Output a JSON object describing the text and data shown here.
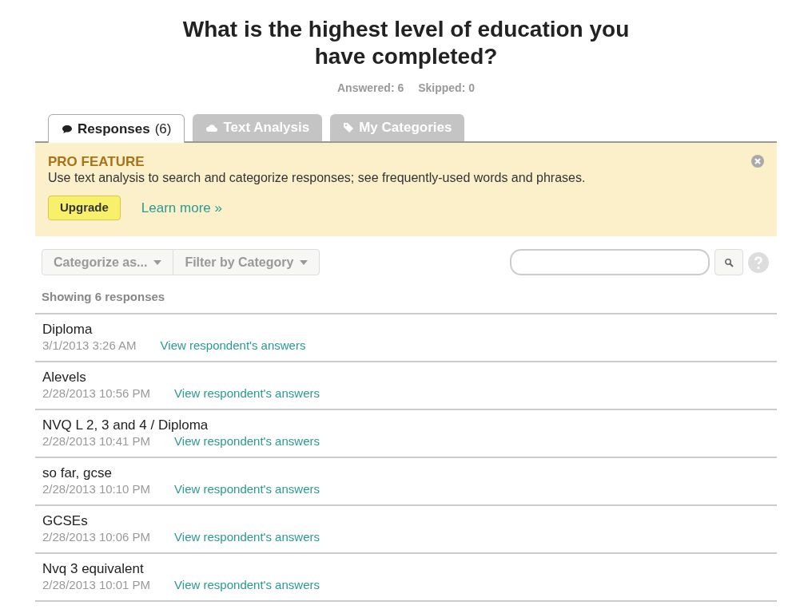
{
  "question": {
    "title": "What is the highest level of education you have completed?",
    "answered": "Answered: 6",
    "skipped": "Skipped: 0"
  },
  "tabs": [
    {
      "kind": "responses",
      "label": "Responses",
      "count": "(6)",
      "selected": true
    },
    {
      "kind": "analysis",
      "label": "Text Analysis",
      "selected": false
    },
    {
      "kind": "categories",
      "label": "My Categories",
      "selected": false
    }
  ],
  "banner": {
    "heading": "PRO FEATURE",
    "text": "Use text analysis to search and categorize responses; see frequently-used words and phrases.",
    "button": "Upgrade",
    "link": "Learn more »"
  },
  "toolbar": {
    "categorize": "Categorize as...",
    "filter": "Filter by Category"
  },
  "showing": "Showing 6 responses",
  "responses": [
    {
      "text": "Diploma",
      "date": "3/1/2013 3:26 AM",
      "link": "View respondent's answers"
    },
    {
      "text": "Alevels",
      "date": "2/28/2013 10:56 PM",
      "link": "View respondent's answers"
    },
    {
      "text": "NVQ L 2, 3 and 4 / Diploma",
      "date": "2/28/2013 10:41 PM",
      "link": "View respondent's answers"
    },
    {
      "text": "so far, gcse",
      "date": "2/28/2013 10:10 PM",
      "link": "View respondent's answers"
    },
    {
      "text": "GCSEs",
      "date": "2/28/2013 10:06 PM",
      "link": "View respondent's answers"
    },
    {
      "text": "Nvq 3 equivalent",
      "date": "2/28/2013 10:01 PM",
      "link": "View respondent's answers"
    }
  ]
}
